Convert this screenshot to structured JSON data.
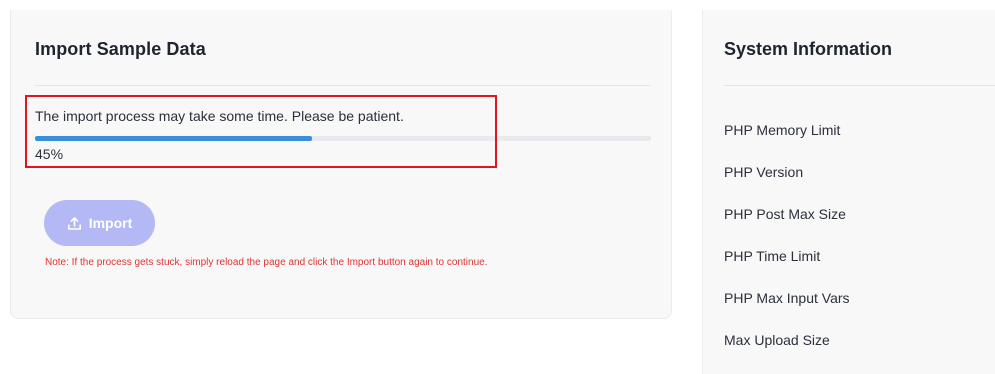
{
  "import_panel": {
    "title": "Import Sample Data",
    "message": "The import process may take some time. Please be patient.",
    "progress_percent": 45,
    "progress_label": "45%",
    "import_button_label": "Import",
    "note": "Note: If the process gets stuck, simply reload the page and click the Import button again to continue."
  },
  "system_panel": {
    "title": "System Information",
    "items": [
      {
        "label": "PHP Memory Limit"
      },
      {
        "label": "PHP Version"
      },
      {
        "label": "PHP Post Max Size"
      },
      {
        "label": "PHP Time Limit"
      },
      {
        "label": "PHP Max Input Vars"
      },
      {
        "label": "Max Upload Size"
      }
    ]
  },
  "colors": {
    "progress_fill": "#3b8fd9",
    "button_bg": "#b4b8f4",
    "note_text": "#e03333",
    "highlight_border": "#e0161f"
  },
  "icons": {
    "import_button_icon": "upload-icon"
  }
}
